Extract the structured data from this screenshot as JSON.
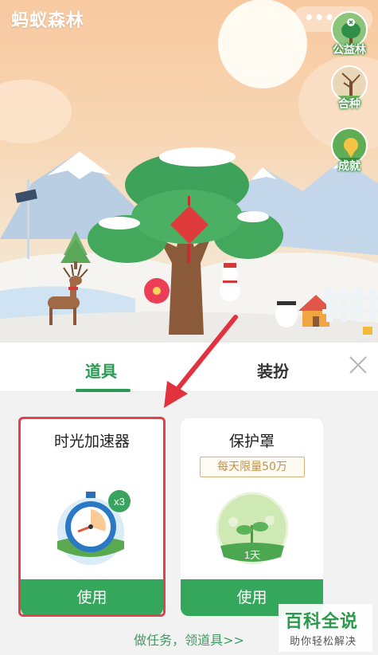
{
  "header": {
    "app_title": "蚂蚁森林",
    "menu_dots": "•••"
  },
  "side_buttons": [
    {
      "label": "公益林",
      "icon": "public-forest-icon"
    },
    {
      "label": "合种",
      "icon": "co-planting-icon"
    },
    {
      "label": "成就",
      "icon": "achievement-icon"
    }
  ],
  "tabs": {
    "tools": "道具",
    "dress_up": "装扮"
  },
  "cards": [
    {
      "title": "时光加速器",
      "multiplier": "x3",
      "button": "使用"
    },
    {
      "title": "保护罩",
      "badge": "每天限量50万",
      "duration": "1天",
      "button": "使用"
    }
  ],
  "task_link": "做任务，领道具>>",
  "watermark": {
    "main": "百科全说",
    "sub": "助你轻松解决"
  },
  "colors": {
    "accent_green": "#2c9a55",
    "button_green": "#35a75c",
    "highlight_red": "#e0434f"
  }
}
